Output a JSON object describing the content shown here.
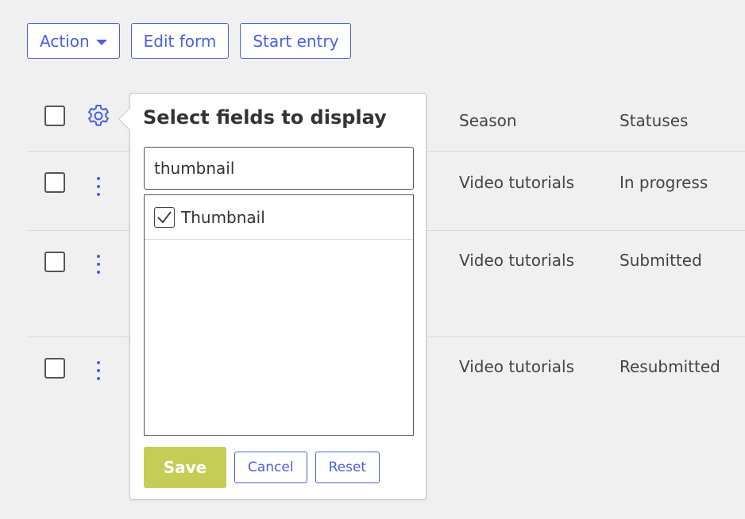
{
  "toolbar": {
    "action_label": "Action",
    "edit_form_label": "Edit form",
    "start_entry_label": "Start entry"
  },
  "table": {
    "columns": {
      "season": "Season",
      "statuses": "Statuses"
    },
    "rows": [
      {
        "season": "Video tutorials",
        "status": "In progress"
      },
      {
        "season": "Video tutorials",
        "status": "Submitted"
      },
      {
        "season": "Video tutorials",
        "status": "Resubmitted"
      }
    ]
  },
  "popover": {
    "title": "Select fields to display",
    "search_value": "thumbnail",
    "fields": [
      {
        "label": "Thumbnail",
        "checked": true
      }
    ],
    "save_label": "Save",
    "cancel_label": "Cancel",
    "reset_label": "Reset"
  },
  "colors": {
    "accent": "#4a5fe0",
    "save": "#c5cd56",
    "background": "#f0f0f1"
  }
}
